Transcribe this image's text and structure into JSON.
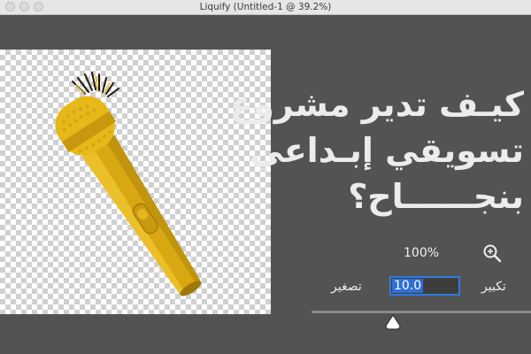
{
  "window": {
    "title": "Liquify (Untitled-1 @ 39.2%)"
  },
  "headline": {
    "line1": "كيـف تدير مشروع",
    "line2": "تسويقي إبـداعي",
    "line3": "بنجــــــاح؟"
  },
  "zoom": {
    "percent_label": "100%",
    "zoom_out_label": "تصغير",
    "zoom_in_label": "تكبير",
    "field_value": "10.0",
    "slider_position": 0.37
  },
  "icons": {
    "zoom_in": "magnifier-plus-icon",
    "slider_thumb": "triangle-up-thumb-icon"
  },
  "colors": {
    "background": "#535353",
    "microphone": "#e8b81a",
    "highlight": "#2f6fd6",
    "text": "#ececec"
  }
}
